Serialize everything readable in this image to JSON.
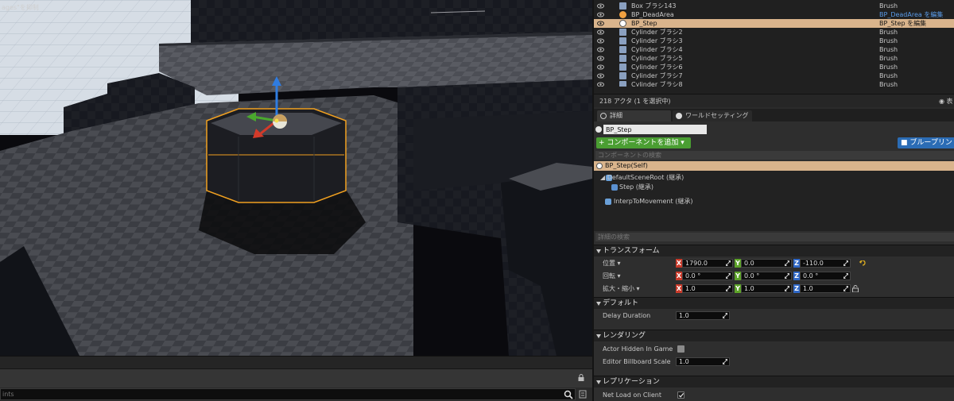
{
  "viewport": {
    "overlay_text": "ages\"を抑制"
  },
  "output_log": {
    "command_placeholder": "ints"
  },
  "outliner": {
    "rows": [
      {
        "name": "Box ブラシ143",
        "type": "Brush",
        "selected": false,
        "link": false
      },
      {
        "name": "BP_DeadArea",
        "type": "BP_DeadArea を編集",
        "selected": false,
        "link": true
      },
      {
        "name": "BP_Step",
        "type": "BP_Step を編集",
        "selected": true,
        "link": false
      },
      {
        "name": "Cylinder ブラシ2",
        "type": "Brush",
        "selected": false,
        "link": false
      },
      {
        "name": "Cylinder ブラシ3",
        "type": "Brush",
        "selected": false,
        "link": false
      },
      {
        "name": "Cylinder ブラシ4",
        "type": "Brush",
        "selected": false,
        "link": false
      },
      {
        "name": "Cylinder ブラシ5",
        "type": "Brush",
        "selected": false,
        "link": false
      },
      {
        "name": "Cylinder ブラシ6",
        "type": "Brush",
        "selected": false,
        "link": false
      },
      {
        "name": "Cylinder ブラシ7",
        "type": "Brush",
        "selected": false,
        "link": false
      },
      {
        "name": "Cylinder ブラシ8",
        "type": "Brush",
        "selected": false,
        "link": false
      }
    ],
    "actor_count": "218 アクタ (1 を選択中)",
    "view_options": "◉ 表"
  },
  "details": {
    "tabs": {
      "details": "詳細",
      "world_settings": "ワールドセッティング"
    },
    "actor_name": "BP_Step",
    "add_component": "+ コンポーネントを追加 ▾",
    "blueprint_button": "■ ブループリン",
    "component_search_placeholder": "コンポーネントの検索",
    "components": [
      {
        "label": "BP_Step(Self)",
        "selected": true,
        "indent": 0
      },
      {
        "label": "◢ DefaultSceneRoot (継承)",
        "selected": false,
        "indent": 1
      },
      {
        "label": "Step (継承)",
        "selected": false,
        "indent": 2
      },
      {
        "label": "InterpToMovement (継承)",
        "selected": false,
        "indent": 1
      }
    ],
    "details_search_placeholder": "詳細の検索",
    "transform": {
      "title": "トランスフォーム",
      "location": {
        "label": "位置 ▾",
        "x": "1790.0",
        "y": "0.0",
        "z": "-110.0"
      },
      "rotation": {
        "label": "回転 ▾",
        "x": "0.0 °",
        "y": "0.0 °",
        "z": "0.0 °"
      },
      "scale": {
        "label": "拡大・縮小 ▾",
        "x": "1.0",
        "y": "1.0",
        "z": "1.0"
      }
    },
    "default_section": {
      "title": "デフォルト",
      "delay_duration_label": "Delay Duration",
      "delay_duration_value": "1.0"
    },
    "rendering": {
      "title": "レンダリング",
      "actor_hidden_label": "Actor Hidden In Game",
      "actor_hidden_checked": false,
      "billboard_label": "Editor Billboard Scale",
      "billboard_value": "1.0"
    },
    "replication": {
      "title": "レプリケーション",
      "net_load_label": "Net Load on Client",
      "net_load_checked": true
    }
  },
  "colors": {
    "selection": "#d9b48c",
    "add_button": "#4a9e32",
    "blueprint_button": "#2b6cb5",
    "link": "#5a9be8",
    "axis_x": "#c93a2a",
    "axis_y": "#5da329",
    "axis_z": "#2f68c7",
    "selection_outline": "#f0a020"
  }
}
